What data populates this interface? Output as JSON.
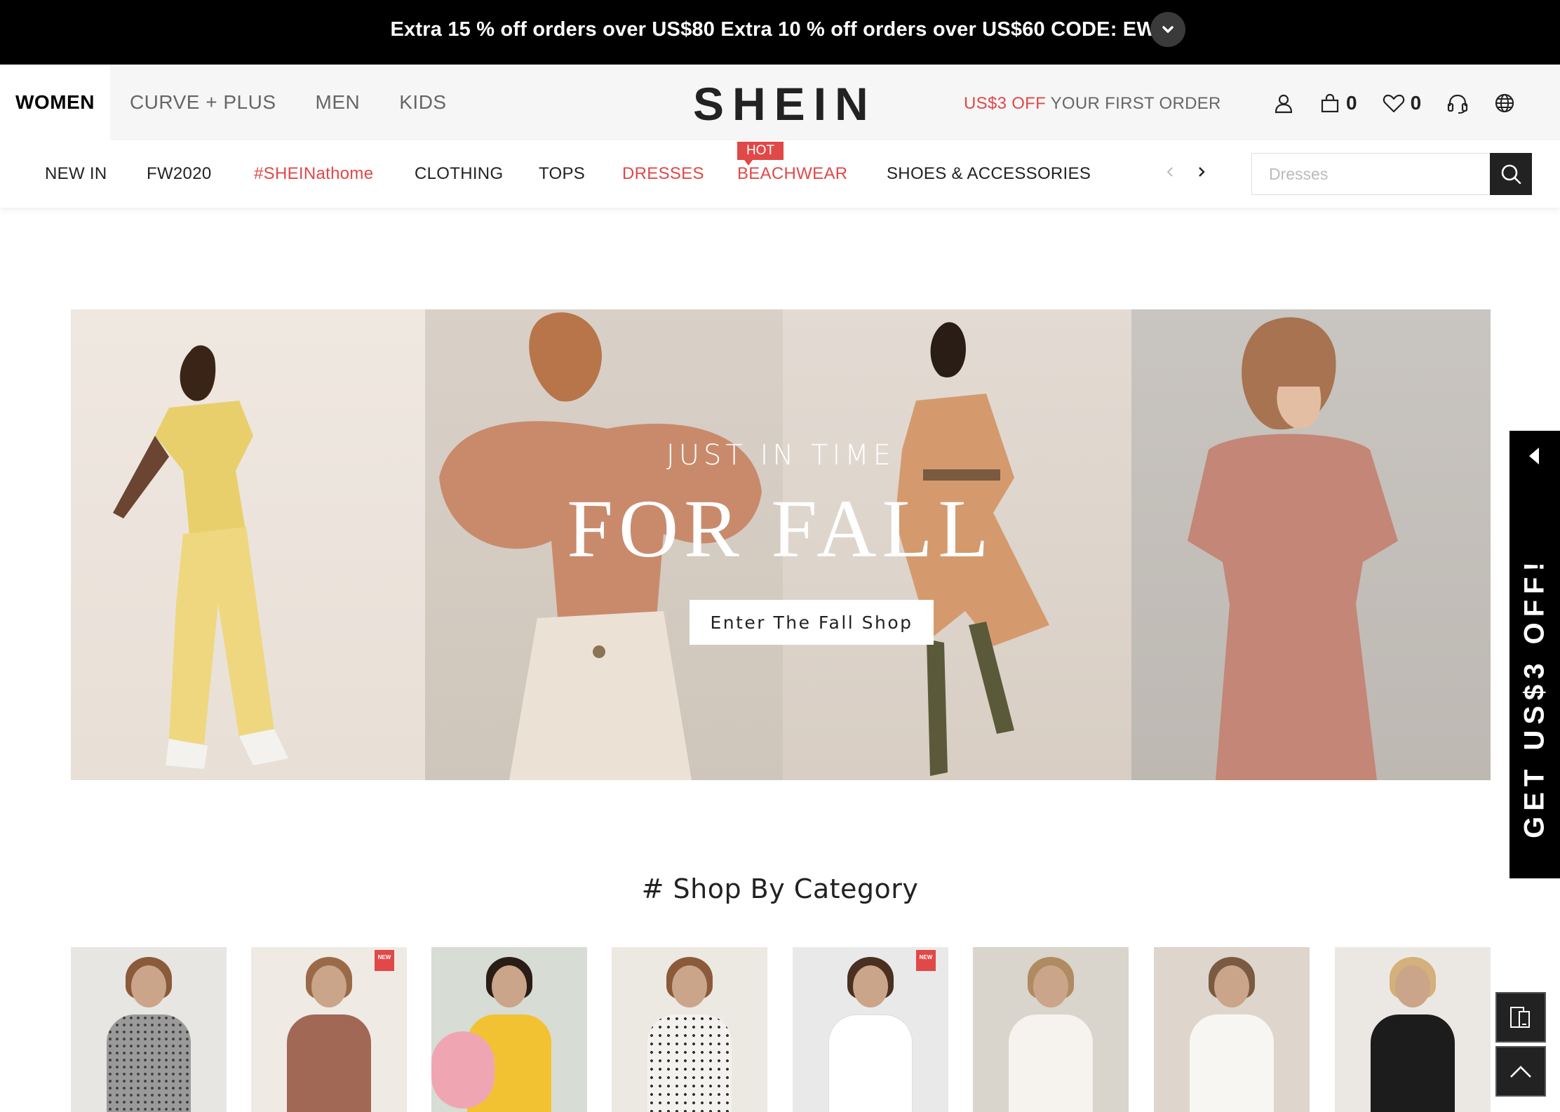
{
  "promo": {
    "text": "Extra 15 % off orders over US$80 Extra 10 % off orders over US$60 CODE: EWX",
    "toggle_icon": "chevron-down-icon"
  },
  "header": {
    "channels": [
      "WOMEN",
      "CURVE + PLUS",
      "MEN",
      "KIDS"
    ],
    "logo": "SHEIN",
    "first_order": {
      "accent": "US$3 OFF",
      "rest": " YOUR FIRST ORDER"
    },
    "bag_count": "0",
    "wishlist_count": "0",
    "icons": [
      "user-icon",
      "bag-icon",
      "heart-icon",
      "headset-icon",
      "globe-icon"
    ]
  },
  "nav": {
    "items": [
      "NEW IN",
      "FW2020",
      "#SHEINathome",
      "CLOTHING",
      "TOPS",
      "DRESSES",
      "BEACHWEAR",
      "SHOES & ACCESSORIES"
    ],
    "hot_badge": "HOT",
    "search_placeholder": "Dresses"
  },
  "hero": {
    "subtitle": "JUST IN TIME",
    "title": "FOR FALL",
    "cta": "Enter The Fall Shop"
  },
  "side_tab": {
    "text": "GET US$3 OFF!"
  },
  "section": {
    "title": "# Shop By Category"
  },
  "category_badges": {
    "new": "NEW"
  },
  "colors": {
    "accent_red": "#e14848",
    "promo_bg": "#000000",
    "header_bg": "#f6f6f6"
  }
}
